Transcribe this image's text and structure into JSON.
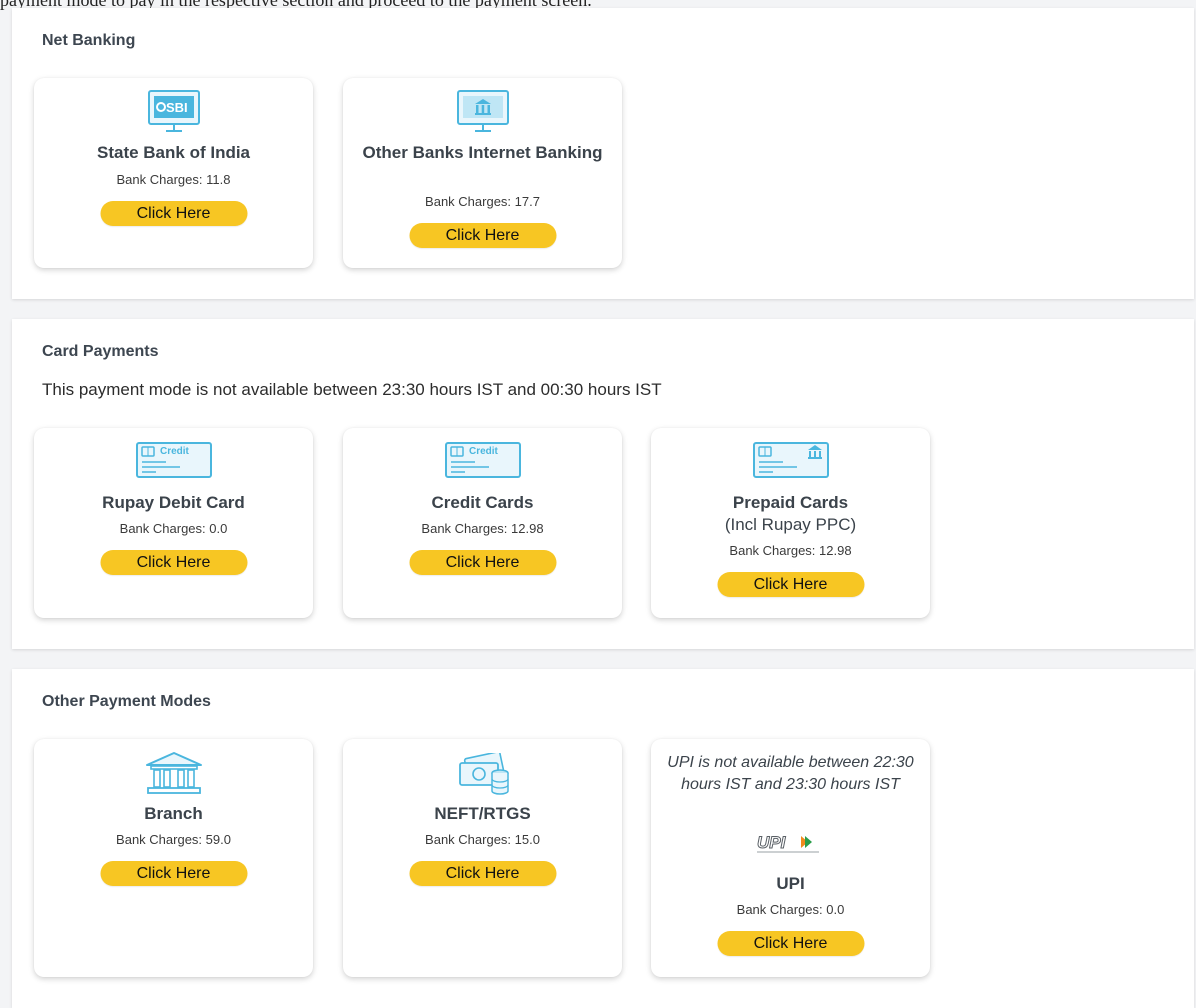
{
  "page": {
    "top_note": "payment mode to pay in the respective section and proceed to the payment screen."
  },
  "sections": {
    "net_banking": {
      "title": "Net Banking",
      "cards": [
        {
          "title": "State Bank of India",
          "charges": "Bank Charges: 11.8",
          "button": "Click Here",
          "icon": "sbi-monitor-icon"
        },
        {
          "title": "Other Banks Internet Banking",
          "charges": "Bank Charges: 17.7",
          "button": "Click Here",
          "icon": "bank-monitor-icon"
        }
      ]
    },
    "card_payments": {
      "title": "Card Payments",
      "note": "This payment mode is not available between 23:30 hours IST and 00:30 hours IST",
      "cards": [
        {
          "title": "Rupay Debit Card",
          "charges": "Bank Charges: 0.0",
          "button": "Click Here",
          "icon": "credit-card-icon",
          "icon_text": "Credit"
        },
        {
          "title": "Credit Cards",
          "charges": "Bank Charges: 12.98",
          "button": "Click Here",
          "icon": "credit-card-icon",
          "icon_text": "Credit"
        },
        {
          "title": "Prepaid Cards",
          "subtitle": "(Incl Rupay PPC)",
          "charges": "Bank Charges: 12.98",
          "button": "Click Here",
          "icon": "prepaid-card-icon"
        }
      ]
    },
    "other_modes": {
      "title": "Other Payment Modes",
      "cards": [
        {
          "title": "Branch",
          "charges": "Bank Charges: 59.0",
          "button": "Click Here",
          "icon": "bank-building-icon"
        },
        {
          "title": "NEFT/RTGS",
          "charges": "Bank Charges: 15.0",
          "button": "Click Here",
          "icon": "cash-coins-icon"
        },
        {
          "note": "UPI is not available between 22:30 hours IST and 23:30 hours IST",
          "logo_text": "UPI",
          "title": "UPI",
          "charges": "Bank Charges: 0.0",
          "button": "Click Here",
          "icon": "upi-logo-icon"
        }
      ]
    }
  },
  "colors": {
    "button": "#f7c623",
    "icon_blue": "#4ab6de",
    "title_text": "#3b434b",
    "page_bg": "#f3f4f6"
  }
}
